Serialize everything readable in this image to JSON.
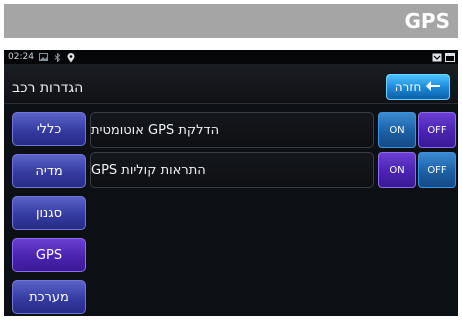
{
  "page": {
    "title": "GPS"
  },
  "status_bar": {
    "time": "02:24"
  },
  "header": {
    "title": "הגדרות רכב",
    "back_label": "חזרה"
  },
  "sidebar": {
    "items": [
      {
        "label": "כללי",
        "active": false
      },
      {
        "label": "מדיה",
        "active": false
      },
      {
        "label": "סגנון",
        "active": false
      },
      {
        "label": "GPS",
        "active": true
      },
      {
        "label": "מערכת",
        "active": false
      }
    ]
  },
  "settings": [
    {
      "label": "הדלקת GPS אוטומטית",
      "on_label": "ON",
      "off_label": "OFF",
      "selected": "off"
    },
    {
      "label": "התראות קוליות GPS",
      "on_label": "ON",
      "off_label": "OFF",
      "selected": "on"
    }
  ],
  "colors": {
    "accent_blue": "#1c86d6",
    "accent_purple": "#4a23b0",
    "title_bar": "#a5a5a5"
  },
  "icons": [
    "image-icon",
    "bluetooth-icon",
    "location-pin-icon",
    "battery-icon",
    "window-icon",
    "back-arrow-icon"
  ]
}
